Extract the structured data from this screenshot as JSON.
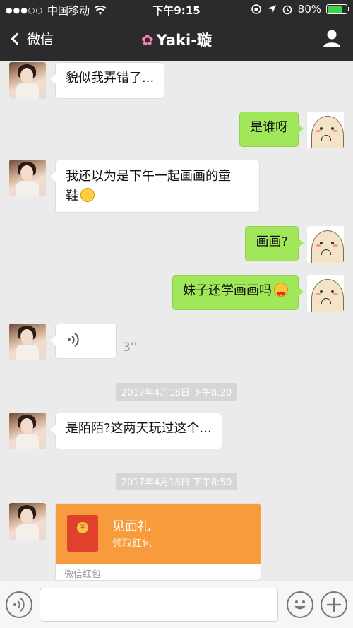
{
  "status_bar": {
    "carrier": "中国移动",
    "time": "下午9:15",
    "battery": "80%",
    "battery_level": 0.8
  },
  "nav": {
    "back_label": "微信",
    "title": "Yaki-璇",
    "title_prefix_icon": "cherry-blossom-emoji"
  },
  "messages": [
    {
      "side": "in",
      "text": "貌似我弄错了..."
    },
    {
      "side": "out",
      "text": "是谁呀"
    },
    {
      "side": "in",
      "text_line1": "我还以为是下午一起画画的童",
      "text_line2": "鞋",
      "emoji": "worried-face"
    },
    {
      "side": "out",
      "text": "画画?"
    },
    {
      "side": "out",
      "text": "妹子还学画画吗",
      "emoji": "heart-eyes-face"
    },
    {
      "side": "in",
      "type": "voice",
      "duration": "3''"
    },
    {
      "type": "timestamp",
      "text": "2017年4月18日 下午8:20"
    },
    {
      "side": "in",
      "text": "是陌陌?这两天玩过这个..."
    },
    {
      "type": "timestamp",
      "text": "2017年4月18日 下午8:50"
    }
  ],
  "red_packet": {
    "title": "见面礼",
    "subtitle": "领取红包",
    "footer": "微信红包",
    "coin_symbol": "¥",
    "color": "#f89b3c"
  },
  "input_bar": {
    "voice_icon": "voice-toggle-icon",
    "emoji_icon": "emoji-icon",
    "plus_icon": "plus-icon",
    "placeholder": ""
  },
  "colors": {
    "nav_bg": "#2b2b2d",
    "chat_bg": "#ebebeb",
    "out_bubble": "#a0e759",
    "in_bubble": "#ffffff"
  }
}
